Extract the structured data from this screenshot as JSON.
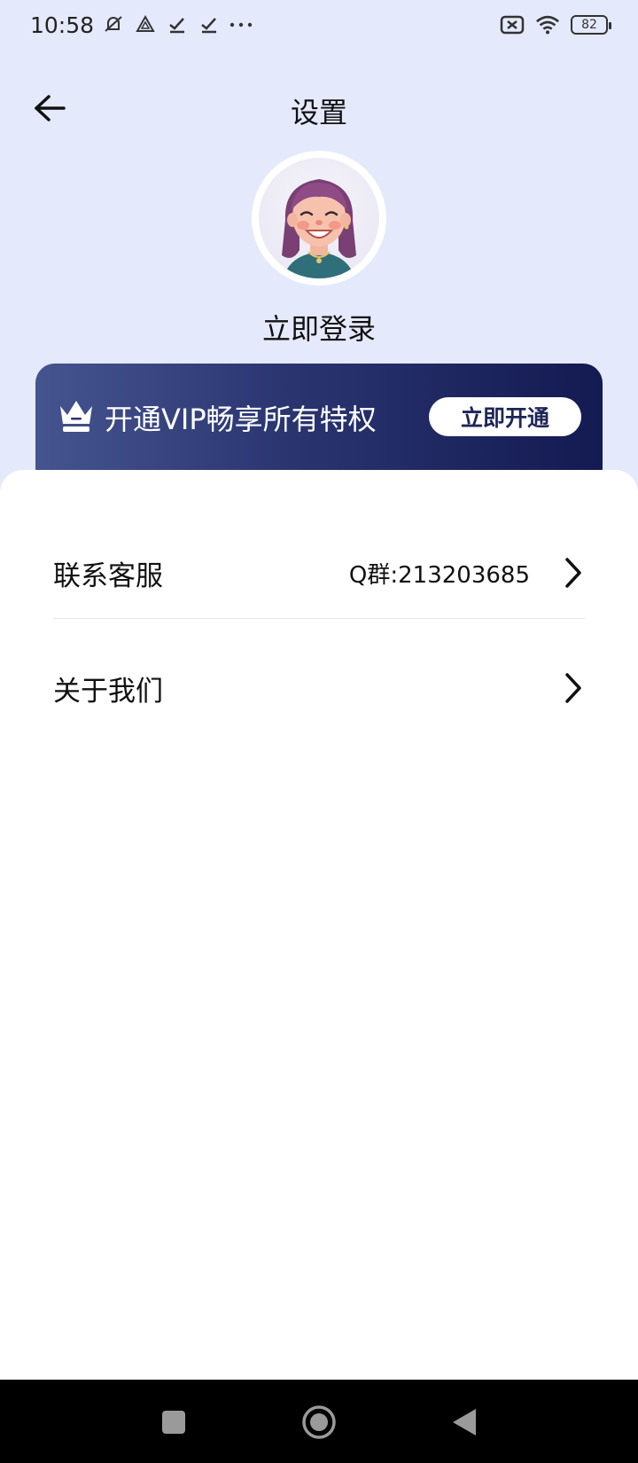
{
  "status_bar": {
    "time": "10:58",
    "battery": "82",
    "icons": [
      "muted-bell-icon",
      "drive-icon",
      "check-icon",
      "check-icon",
      "more-dots-icon",
      "sim-off-icon",
      "wifi-icon",
      "battery-icon"
    ]
  },
  "header": {
    "title": "设置",
    "back_icon": "arrow-left-icon"
  },
  "profile": {
    "login_text": "立即登录"
  },
  "vip": {
    "text": "开通VIP畅享所有特权",
    "button_label": "立即开通",
    "crown_icon": "crown-icon"
  },
  "settings": [
    {
      "label": "联系客服",
      "value": "Q群:213203685"
    },
    {
      "label": "关于我们",
      "value": ""
    }
  ],
  "colors": {
    "background": "#e5e9fc",
    "vip_gradient_start": "#45548f",
    "vip_gradient_end": "#141a52",
    "vip_button_text": "#1e2657"
  }
}
